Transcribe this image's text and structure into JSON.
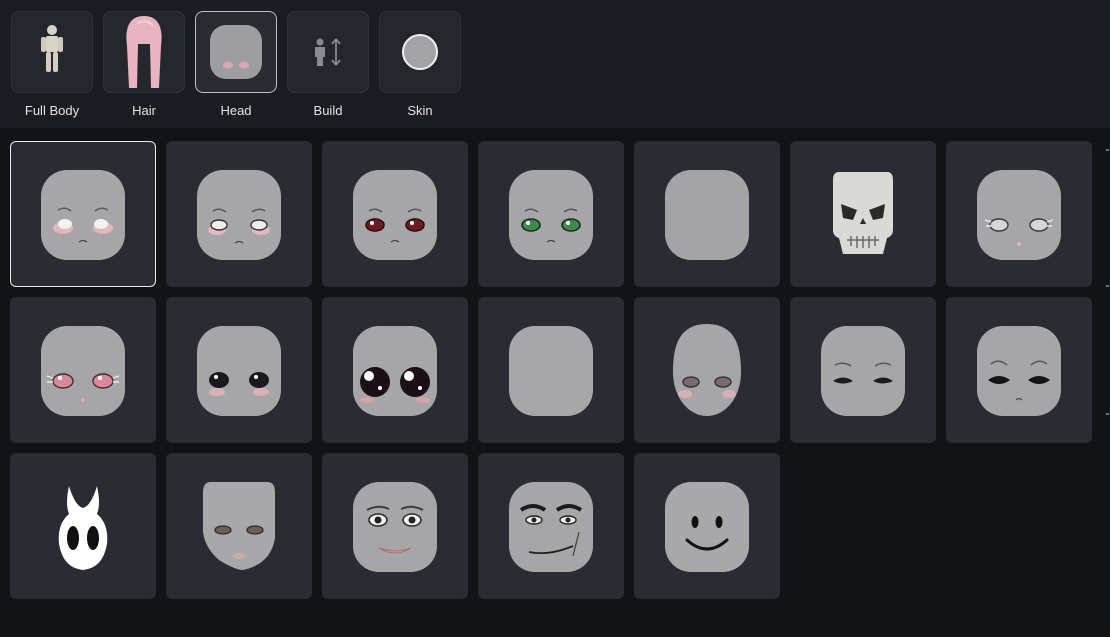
{
  "categories": [
    {
      "label": "Full Body",
      "icon": "full-body-icon",
      "selected": false
    },
    {
      "label": "Hair",
      "icon": "hair-icon",
      "selected": false
    },
    {
      "label": "Head",
      "icon": "head-icon",
      "selected": true
    },
    {
      "label": "Build",
      "icon": "build-icon",
      "selected": false
    },
    {
      "label": "Skin",
      "icon": "skin-icon",
      "selected": false
    }
  ],
  "heads": [
    {
      "face": "sad-blush-face",
      "selected": true
    },
    {
      "face": "sad-blush-face"
    },
    {
      "face": "sad-red-eyes-face"
    },
    {
      "face": "sad-green-eyes-face"
    },
    {
      "face": "blank-face"
    },
    {
      "face": "skull-face"
    },
    {
      "face": "lash-grey-eyes-face"
    },
    {
      "face": "pink-eyes-face"
    },
    {
      "face": "dark-eyes-face"
    },
    {
      "face": "big-shiny-eyes-face"
    },
    {
      "face": "blank-face"
    },
    {
      "face": "realistic-eyes-face"
    },
    {
      "face": "half-closed-eyes-face"
    },
    {
      "face": "worried-dark-eyes-face"
    },
    {
      "face": "hollow-mask-face"
    },
    {
      "face": "realistic-female-face"
    },
    {
      "face": "smiling-woman-face"
    },
    {
      "face": "smirk-man-face"
    },
    {
      "face": "classic-smile-face"
    }
  ],
  "colors": {
    "tile_bg": "#2a2b33",
    "header_bg": "#1b1c21",
    "page_bg": "#121317",
    "skin": "#a6a6a9",
    "selection_border": "#e9e9ec"
  }
}
